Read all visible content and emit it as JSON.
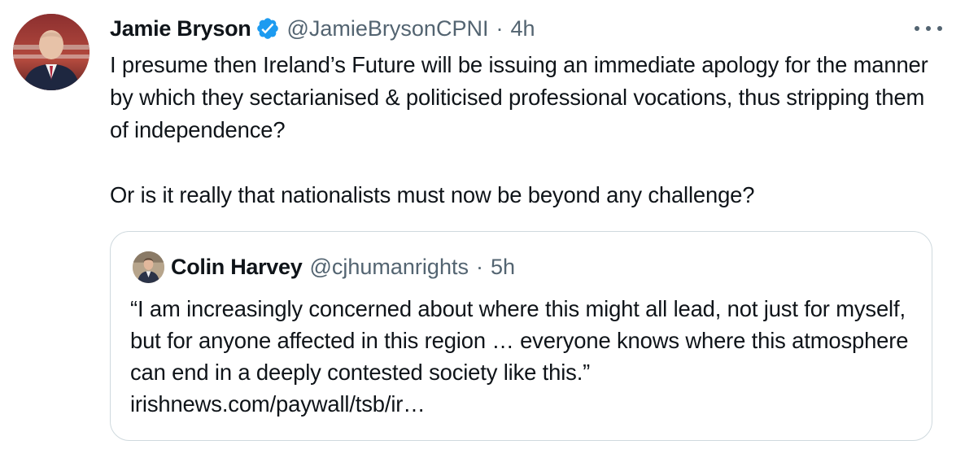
{
  "tweet": {
    "author": {
      "display_name": "Jamie Bryson",
      "handle": "@JamieBrysonCPNI",
      "verified": true,
      "verified_color": "#1d9bf0"
    },
    "separator": "·",
    "time": "4h",
    "more_icon": "more-horizontal-icon",
    "text_paragraphs": [
      "I presume then Ireland’s Future will be issuing an immediate apology for the manner by which they sectarianised & politicised professional vocations, thus stripping them of independence?",
      "Or is it really that nationalists must now be beyond any challenge?"
    ]
  },
  "quoted_tweet": {
    "author": {
      "display_name": "Colin Harvey",
      "handle": "@cjhumanrights"
    },
    "separator": "·",
    "time": "5h",
    "text": "“I am increasingly concerned about where this might all lead, not just for myself, but for anyone affected in this region … everyone knows where this atmosphere can end in a deeply contested society like this.”",
    "link": "irishnews.com/paywall/tsb/ir…"
  },
  "colors": {
    "text_primary": "#0f1419",
    "text_secondary": "#536471",
    "border": "#cfd9de",
    "verified_blue": "#1d9bf0"
  }
}
